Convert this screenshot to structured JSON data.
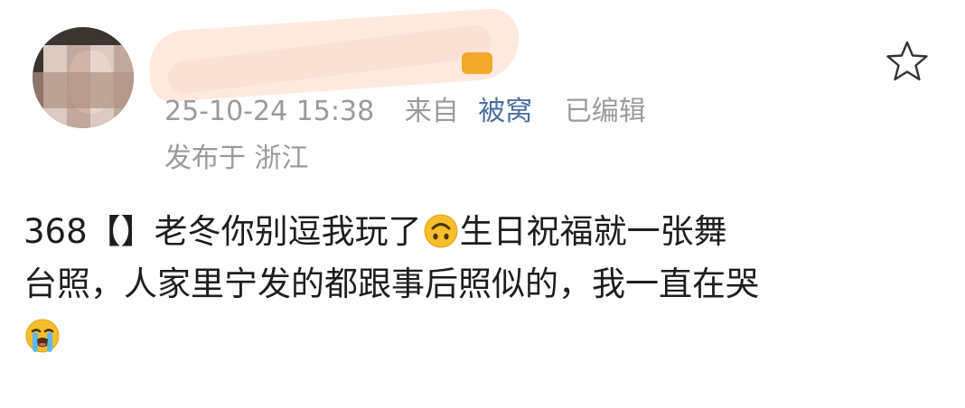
{
  "header": {
    "username": "",
    "vip_badge": "",
    "timestamp": "25-10-24 15:38",
    "from_label": "来自",
    "source": "被窝",
    "edited_label": "已编辑",
    "location": "发布于 浙江"
  },
  "content": {
    "line1_text": "368【】老冬你别逗我玩了",
    "line1_emoji": "upside-down-face",
    "line1_tail": "生日祝福就一张舞",
    "line2": "台照，人家里宁发的都跟事后照似的，我一直在哭",
    "line3_emoji": "loudly-crying-face"
  },
  "icons": {
    "favorite": "star-outline-icon",
    "avatar": "avatar-icon"
  },
  "colors": {
    "link": "#4d6f9e",
    "meta": "#9b9b9b",
    "text": "#1d1d1d",
    "emoji_yellow": "#f7be2c"
  }
}
